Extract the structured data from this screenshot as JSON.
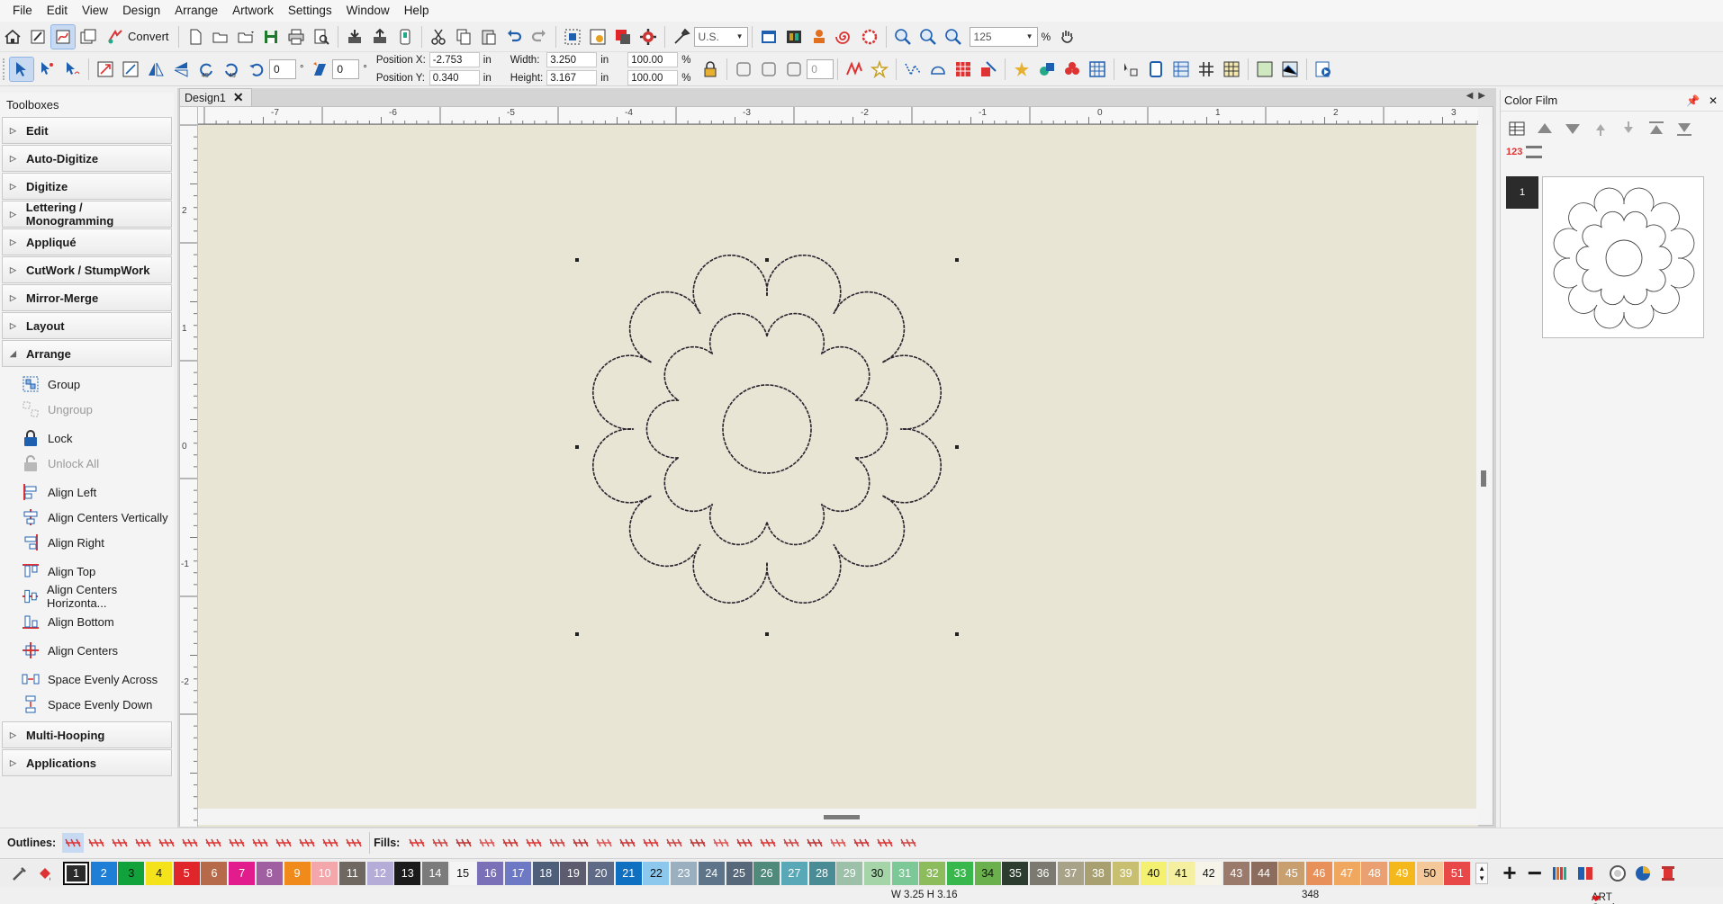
{
  "menu": [
    "File",
    "Edit",
    "View",
    "Design",
    "Arrange",
    "Artwork",
    "Settings",
    "Window",
    "Help"
  ],
  "toolbar": {
    "convert_label": "Convert",
    "units": "U.S.",
    "zoom_value": "125",
    "zoom_unit": "%",
    "rotate_value": "0",
    "slant_value": "0",
    "degree_symbol": "°",
    "lock_value": "0"
  },
  "properties": {
    "pos_x_label": "Position X:",
    "pos_x_value": "-2.753",
    "pos_y_label": "Position Y:",
    "pos_y_value": "0.340",
    "width_label": "Width:",
    "width_value": "3.250",
    "height_label": "Height:",
    "height_value": "3.167",
    "unit": "in",
    "scale_w": "100.00",
    "scale_h": "100.00",
    "percent": "%"
  },
  "toolboxes": {
    "title": "Toolboxes",
    "sections_top": [
      "Edit",
      "Auto-Digitize",
      "Digitize",
      "Lettering / Monogramming",
      "Appliqué",
      "CutWork / StumpWork",
      "Mirror-Merge",
      "Layout"
    ],
    "arrange": {
      "label": "Arrange",
      "tools": [
        {
          "label": "Group",
          "icon": "group-icon",
          "disabled": false
        },
        {
          "label": "Ungroup",
          "icon": "ungroup-icon",
          "disabled": true
        },
        {
          "label": "Lock",
          "icon": "lock-icon",
          "disabled": false
        },
        {
          "label": "Unlock All",
          "icon": "unlock-icon",
          "disabled": true
        },
        {
          "label": "Align Left",
          "icon": "align-left-icon",
          "disabled": false
        },
        {
          "label": "Align Centers Vertically",
          "icon": "align-center-v-icon",
          "disabled": false
        },
        {
          "label": "Align Right",
          "icon": "align-right-icon",
          "disabled": false
        },
        {
          "label": "Align Top",
          "icon": "align-top-icon",
          "disabled": false
        },
        {
          "label": "Align Centers Horizonta...",
          "icon": "align-center-h-icon",
          "disabled": false
        },
        {
          "label": "Align Bottom",
          "icon": "align-bottom-icon",
          "disabled": false
        },
        {
          "label": "Align Centers",
          "icon": "align-centers-icon",
          "disabled": false
        },
        {
          "label": "Space Evenly Across",
          "icon": "space-across-icon",
          "disabled": false
        },
        {
          "label": "Space Evenly Down",
          "icon": "space-down-icon",
          "disabled": false
        }
      ]
    },
    "sections_bottom": [
      "Multi-Hooping",
      "Applications"
    ]
  },
  "document": {
    "tab_label": "Design1",
    "ruler_x_labels": [
      "-7",
      "-6",
      "-5",
      "-4",
      "-3",
      "-2",
      "-1",
      "0",
      "1",
      "2",
      "3"
    ],
    "ruler_y_labels": [
      "2",
      "1",
      "0",
      "-1",
      "-2"
    ]
  },
  "color_film": {
    "title": "Color Film",
    "order_label": "123",
    "item_number": "1"
  },
  "stitchbar": {
    "outlines_label": "Outlines:",
    "fills_label": "Fills:"
  },
  "palette": {
    "swatches": [
      {
        "n": "1",
        "color": "#2a2a2a",
        "text": "#ffffff"
      },
      {
        "n": "2",
        "color": "#1f7fd6",
        "text": "#ffffff"
      },
      {
        "n": "3",
        "color": "#12a23c",
        "text": "#111111"
      },
      {
        "n": "4",
        "color": "#f4e21a",
        "text": "#111111"
      },
      {
        "n": "5",
        "color": "#e0262b",
        "text": "#ffffff"
      },
      {
        "n": "6",
        "color": "#b66a4a",
        "text": "#ffffff"
      },
      {
        "n": "7",
        "color": "#e21c8c",
        "text": "#ffffff"
      },
      {
        "n": "8",
        "color": "#a05fa0",
        "text": "#ffffff"
      },
      {
        "n": "9",
        "color": "#ef8a1b",
        "text": "#ffffff"
      },
      {
        "n": "10",
        "color": "#f4a7ab",
        "text": "#ffffff"
      },
      {
        "n": "11",
        "color": "#6e6860",
        "text": "#ffffff"
      },
      {
        "n": "12",
        "color": "#b6acd8",
        "text": "#ffffff"
      },
      {
        "n": "13",
        "color": "#1b1b1b",
        "text": "#ffffff"
      },
      {
        "n": "14",
        "color": "#7b7b7b",
        "text": "#ffffff"
      },
      {
        "n": "15",
        "color": "#f4f4f4",
        "text": "#111111"
      },
      {
        "n": "16",
        "color": "#7a70b8",
        "text": "#ffffff"
      },
      {
        "n": "17",
        "color": "#6d79c4",
        "text": "#ffffff"
      },
      {
        "n": "18",
        "color": "#4f5f7a",
        "text": "#ffffff"
      },
      {
        "n": "19",
        "color": "#5c5c6e",
        "text": "#ffffff"
      },
      {
        "n": "20",
        "color": "#5e6a86",
        "text": "#ffffff"
      },
      {
        "n": "21",
        "color": "#0f6fc0",
        "text": "#ffffff"
      },
      {
        "n": "22",
        "color": "#8cc8ee",
        "text": "#111111"
      },
      {
        "n": "23",
        "color": "#9ab0c0",
        "text": "#ffffff"
      },
      {
        "n": "24",
        "color": "#5e7488",
        "text": "#ffffff"
      },
      {
        "n": "25",
        "color": "#56687a",
        "text": "#ffffff"
      },
      {
        "n": "26",
        "color": "#4f8a7a",
        "text": "#ffffff"
      },
      {
        "n": "27",
        "color": "#58a8b8",
        "text": "#ffffff"
      },
      {
        "n": "28",
        "color": "#4a8c96",
        "text": "#ffffff"
      },
      {
        "n": "29",
        "color": "#9cc0a8",
        "text": "#ffffff"
      },
      {
        "n": "30",
        "color": "#a4d4a8",
        "text": "#111111"
      },
      {
        "n": "31",
        "color": "#7cc896",
        "text": "#ffffff"
      },
      {
        "n": "32",
        "color": "#8cbc5c",
        "text": "#ffffff"
      },
      {
        "n": "33",
        "color": "#38b84c",
        "text": "#ffffff"
      },
      {
        "n": "34",
        "color": "#6ab04c",
        "text": "#111111"
      },
      {
        "n": "35",
        "color": "#2c3c2e",
        "text": "#ffffff"
      },
      {
        "n": "36",
        "color": "#7c7a70",
        "text": "#ffffff"
      },
      {
        "n": "37",
        "color": "#a8a288",
        "text": "#ffffff"
      },
      {
        "n": "38",
        "color": "#a8a070",
        "text": "#ffffff"
      },
      {
        "n": "39",
        "color": "#c8c070",
        "text": "#ffffff"
      },
      {
        "n": "40",
        "color": "#f4f070",
        "text": "#111111"
      },
      {
        "n": "41",
        "color": "#f4f0a0",
        "text": "#111111"
      },
      {
        "n": "42",
        "color": "#f6f4e8",
        "text": "#111111"
      },
      {
        "n": "43",
        "color": "#9a7a6a",
        "text": "#ffffff"
      },
      {
        "n": "44",
        "color": "#8c6c5c",
        "text": "#ffffff"
      },
      {
        "n": "45",
        "color": "#c8a070",
        "text": "#ffffff"
      },
      {
        "n": "46",
        "color": "#e8905a",
        "text": "#ffffff"
      },
      {
        "n": "47",
        "color": "#f0a860",
        "text": "#ffffff"
      },
      {
        "n": "48",
        "color": "#eaa070",
        "text": "#ffffff"
      },
      {
        "n": "49",
        "color": "#f4b81c",
        "text": "#ffffff"
      },
      {
        "n": "50",
        "color": "#f4c898",
        "text": "#111111"
      },
      {
        "n": "51",
        "color": "#e84848",
        "text": "#ffffff"
      }
    ]
  },
  "status": {
    "size_text": "W 3.25 H 3.16",
    "stitch_count": "348",
    "grade_text": "ART Grade: A"
  }
}
